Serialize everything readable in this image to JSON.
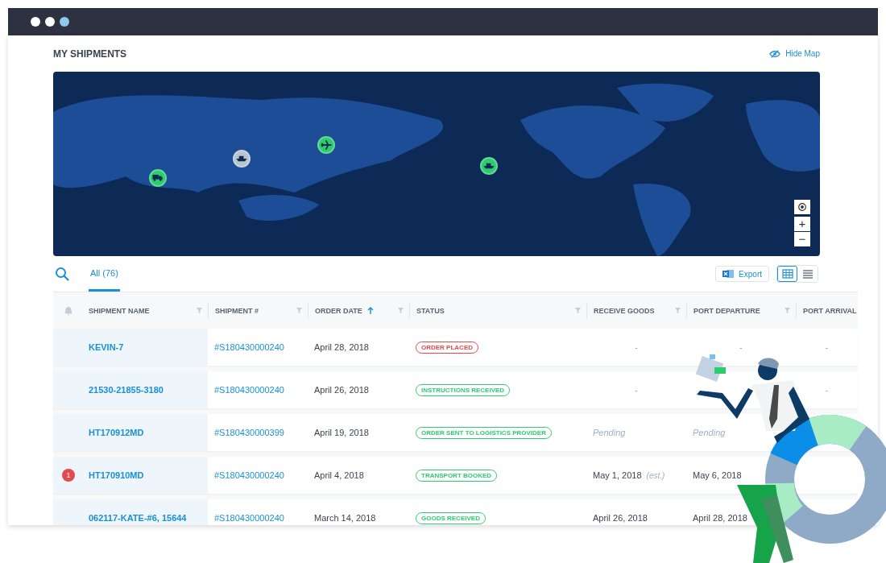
{
  "window": {
    "dots": [
      {
        "color": "#ffffff"
      },
      {
        "color": "#ffffff"
      },
      {
        "color": "#8ec9ee"
      }
    ]
  },
  "header": {
    "title": "MY SHIPMENTS",
    "hide_map": "Hide Map"
  },
  "map": {
    "markers": [
      {
        "kind": "truck",
        "color": "#2ecc71"
      },
      {
        "kind": "ship",
        "color": "#b8c4d0"
      },
      {
        "kind": "plane",
        "color": "#2ecc71"
      },
      {
        "kind": "ship",
        "color": "#2ecc71"
      }
    ],
    "zoom_in": "+",
    "zoom_out": "−"
  },
  "tabs": [
    {
      "label": "All (76)",
      "selected": true
    }
  ],
  "export": "Export",
  "view_toggle": [
    {
      "kind": "grid",
      "selected": true
    },
    {
      "kind": "list",
      "selected": false
    }
  ],
  "table": {
    "columns": [
      {
        "kind": "alert"
      },
      {
        "kind": "text",
        "label": "SHIPMENT NAME",
        "filter": true
      },
      {
        "kind": "text",
        "label": "SHIPMENT #",
        "filter": true
      },
      {
        "kind": "text",
        "label": "ORDER DATE",
        "filter": true,
        "sorted": true
      },
      {
        "kind": "text",
        "label": "STATUS",
        "filter": true
      },
      {
        "kind": "text",
        "label": "RECEIVE GOODS",
        "filter": true
      },
      {
        "kind": "text",
        "label": "PORT DEPARTURE",
        "filter": true
      },
      {
        "kind": "text",
        "label": "PORT ARRIVAL",
        "filter": false
      }
    ],
    "rows": [
      {
        "name": "KEVIN-7",
        "number": "#S180430000240",
        "date": "April 28, 2018",
        "status": {
          "label": "ORDER PLACED",
          "color": "#e5484d"
        },
        "cells": [
          {
            "kind": "dash",
            "text": "-"
          },
          {
            "kind": "dash",
            "text": "-"
          },
          {
            "kind": "dash",
            "text": "-"
          }
        ]
      },
      {
        "name": "21530-21855-3180",
        "number": "#S180430000240",
        "date": "April 26, 2018",
        "status": {
          "label": "INSTRUCTIONS RECEIVED",
          "color": "#2ecc71"
        },
        "cells": [
          {
            "kind": "dash",
            "text": "-"
          },
          null,
          {
            "kind": "dash",
            "text": "-"
          }
        ]
      },
      {
        "name": "HT170912MD",
        "number": "#S180430000399",
        "date": "April 19, 2018",
        "status": {
          "label": "ORDER SENT TO LOGISTICS PROVIDER",
          "color": "#2ecc71"
        },
        "cells": [
          {
            "kind": "pending",
            "text": "Pending"
          },
          {
            "kind": "pending",
            "text": "Pending"
          },
          null
        ]
      },
      {
        "alert": "1",
        "name": "HT170910MD",
        "number": "#S180430000240",
        "date": "April 4, 2018",
        "status": {
          "label": "TRANSPORT BOOKED",
          "color": "#2ecc71"
        },
        "cells": [
          {
            "kind": "date",
            "text": "May 1, 2018",
            "note": "(est.)"
          },
          {
            "kind": "date",
            "text": "May 6, 2018"
          },
          null
        ]
      },
      {
        "name": "062117-KATE-#6, 15644",
        "number": "#S180430000240",
        "date": "March 14, 2018",
        "status": {
          "label": "GOODS RECEIVED",
          "color": "#2ecc71"
        },
        "cells": [
          {
            "kind": "date",
            "text": "April 26, 2018"
          },
          {
            "kind": "date",
            "text": "April 28, 2018"
          },
          null
        ]
      }
    ]
  }
}
